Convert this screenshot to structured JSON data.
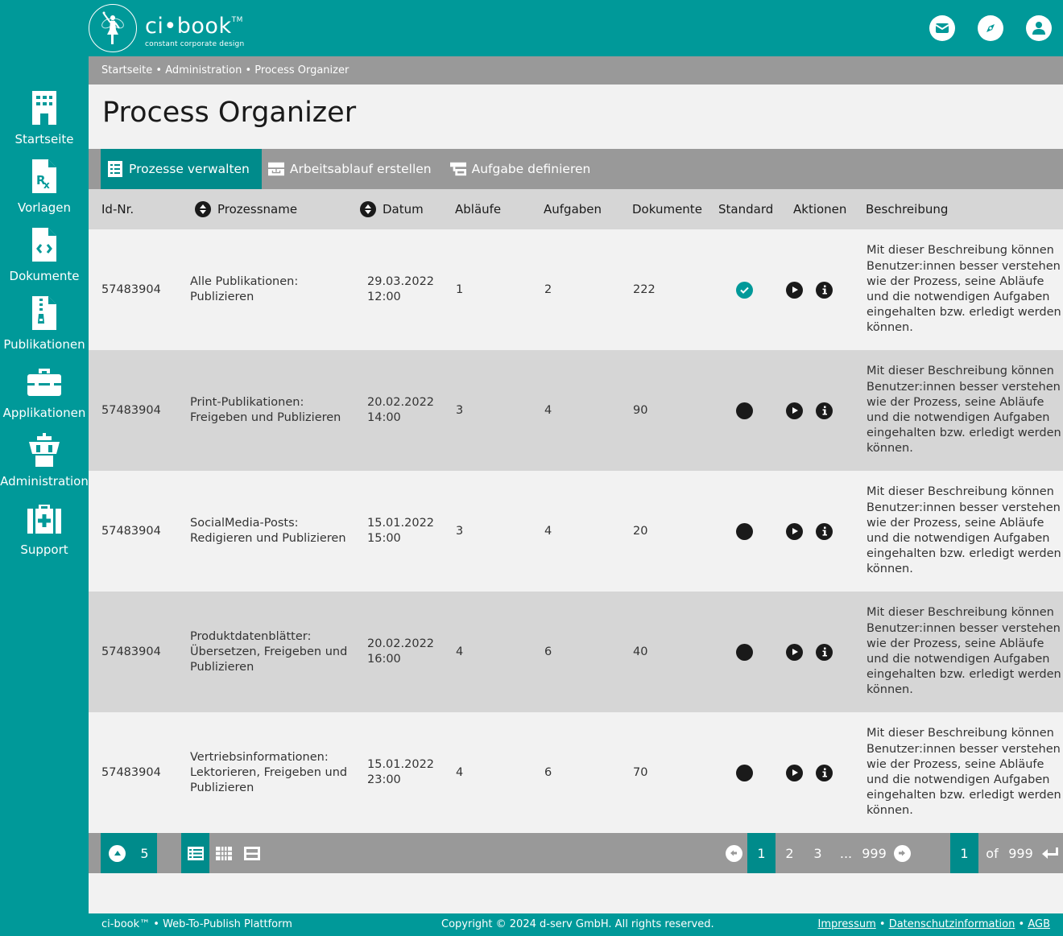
{
  "header": {
    "logo_title": "ci•book",
    "logo_tm": "TM",
    "logo_subtitle": "constant corporate design",
    "icons": [
      "mail-icon",
      "compass-icon",
      "user-icon"
    ]
  },
  "sidebar": {
    "items": [
      {
        "label": "Startseite",
        "icon": "building-icon"
      },
      {
        "label": "Vorlagen",
        "icon": "prescription-file-icon"
      },
      {
        "label": "Dokumente",
        "icon": "code-file-icon"
      },
      {
        "label": "Publikationen",
        "icon": "zip-file-icon"
      },
      {
        "label": "Applikationen",
        "icon": "toolbox-icon"
      },
      {
        "label": "Administration",
        "icon": "control-tower-icon"
      },
      {
        "label": "Support",
        "icon": "medkit-icon"
      }
    ]
  },
  "breadcrumb": {
    "items": [
      "Startseite",
      "Administration",
      "Process Organizer"
    ],
    "separator": "•"
  },
  "page": {
    "title": "Process Organizer"
  },
  "tabs": [
    {
      "label": "Prozesse verwalten",
      "icon": "list-icon",
      "active": true
    },
    {
      "label": "Arbeitsablauf erstellen",
      "icon": "workflow-icon",
      "active": false
    },
    {
      "label": "Aufgabe definieren",
      "icon": "task-icon",
      "active": false
    }
  ],
  "table": {
    "columns": [
      "Id-Nr.",
      "Prozessname",
      "Datum",
      "Abläufe",
      "Aufgaben",
      "Dokumente",
      "Standard",
      "Aktionen",
      "Beschreibung"
    ],
    "rows": [
      {
        "id": "57483904",
        "name": "Alle Publikationen: Publizieren",
        "date": "29.03.2022",
        "time": "12:00",
        "ablaeufe": "1",
        "aufgaben": "2",
        "dokumente": "222",
        "standard": true,
        "description": "Mit dieser Beschreibung können Benutzer:innen besser verstehen wie der Prozess, seine Abläufe und die notwendigen Aufgaben eingehalten bzw. erledigt werden können."
      },
      {
        "id": "57483904",
        "name": "Print-Publikationen: Freigeben und Publizieren",
        "date": "20.02.2022",
        "time": "14:00",
        "ablaeufe": "3",
        "aufgaben": "4",
        "dokumente": "90",
        "standard": false,
        "description": "Mit dieser Beschreibung können Benutzer:innen besser verstehen wie der Prozess, seine Abläufe und die notwendigen Aufgaben eingehalten bzw. erledigt werden können."
      },
      {
        "id": "57483904",
        "name": "SocialMedia-Posts: Redigieren und Publizieren",
        "date": "15.01.2022",
        "time": "15:00",
        "ablaeufe": "3",
        "aufgaben": "4",
        "dokumente": "20",
        "standard": false,
        "description": "Mit dieser Beschreibung können Benutzer:innen besser verstehen wie der Prozess, seine Abläufe und die notwendigen Aufgaben eingehalten bzw. erledigt werden können."
      },
      {
        "id": "57483904",
        "name": "Produktdatenblätter: Übersetzen, Freigeben und Publizieren",
        "date": "20.02.2022",
        "time": "16:00",
        "ablaeufe": "4",
        "aufgaben": "6",
        "dokumente": "40",
        "standard": false,
        "description": "Mit dieser Beschreibung können Benutzer:innen besser verstehen wie der Prozess, seine Abläufe und die notwendigen Aufgaben eingehalten bzw. erledigt werden können."
      },
      {
        "id": "57483904",
        "name": "Vertriebsinformationen: Lektorieren, Freigeben und Publizieren",
        "date": "15.01.2022",
        "time": "23:00",
        "ablaeufe": "4",
        "aufgaben": "6",
        "dokumente": "70",
        "standard": false,
        "description": "Mit dieser Beschreibung können Benutzer:innen besser verstehen wie der Prozess, seine Abläufe und die notwendigen Aufgaben eingehalten bzw. erledigt werden können."
      }
    ]
  },
  "pager": {
    "rows_per_page": "5",
    "views": [
      "list-view-icon",
      "grid-view-icon",
      "split-view-icon"
    ],
    "active_view": "list-view-icon",
    "pages": [
      "1",
      "2",
      "3",
      "...",
      "999"
    ],
    "current_page": "1",
    "goto_value": "1",
    "of_label": "of",
    "total_pages": "999"
  },
  "footer": {
    "left": "ci-book™ • Web-To-Publish Plattform",
    "copyright": "Copyright © 2024 d-serv GmbH. All rights reserved.",
    "links": [
      "Impressum",
      "Datenschutzinformation",
      "AGB"
    ],
    "separator": "•"
  },
  "colors": {
    "brand": "#009999",
    "brand_dark": "#008b8b",
    "bar_gray": "#999999",
    "row_alt": "#d6d6d6",
    "bg": "#f2f2f2"
  }
}
